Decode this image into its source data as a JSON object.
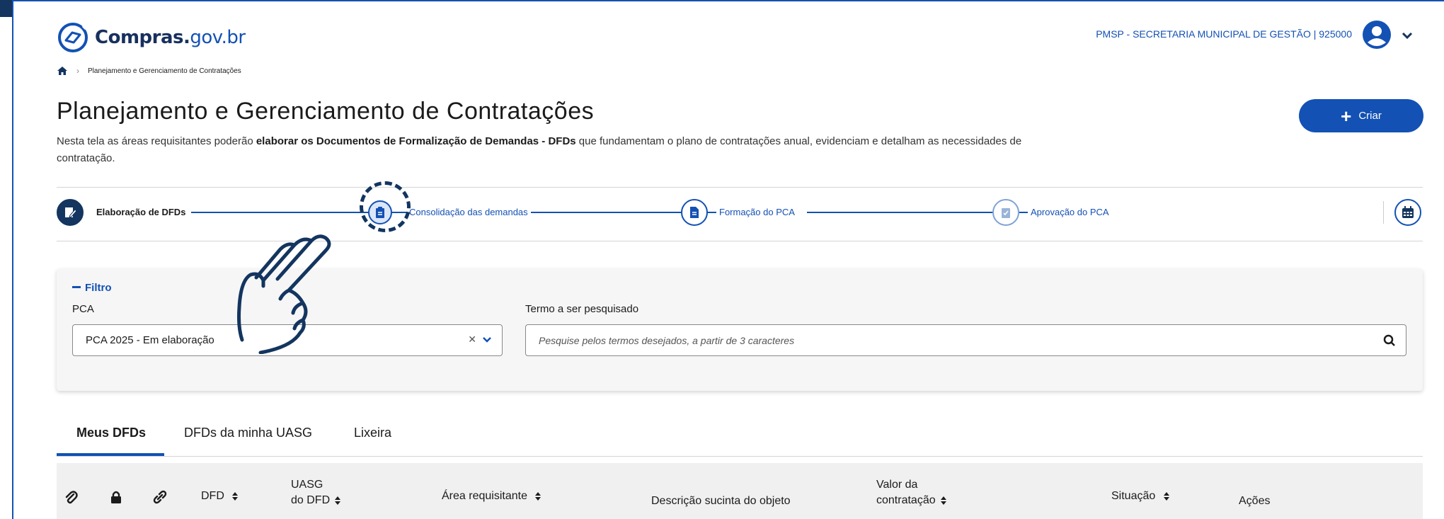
{
  "header": {
    "logo_text_main": "Compras.",
    "logo_text_suffix": "gov.br",
    "org_label": "PMSP - SECRETARIA MUNICIPAL DE GESTÃO | 925000"
  },
  "breadcrumb": {
    "current": "Planejamento e Gerenciamento de Contratações"
  },
  "page": {
    "title": "Planejamento e Gerenciamento de Contratações",
    "desc_part1": "Nesta tela as áreas requisitantes poderão ",
    "desc_bold": "elaborar os Documentos de Formalização de Demandas - DFDs",
    "desc_part2": " que fundamentam o plano de contratações anual, evidenciam e detalham as necessidades de contratação.",
    "create_label": "Criar"
  },
  "stepper": {
    "steps": [
      {
        "label": "Elaboração de DFDs",
        "icon": "edit-document-icon",
        "state": "active"
      },
      {
        "label": "Consolidação das demandas",
        "icon": "clipboard-icon",
        "state": "highlighted"
      },
      {
        "label": "Formação do PCA",
        "icon": "file-icon",
        "state": "default"
      },
      {
        "label": "Aprovação do PCA",
        "icon": "checklist-icon",
        "state": "muted"
      }
    ],
    "calendar_icon": "calendar-icon"
  },
  "filter": {
    "toggle_label": "Filtro",
    "pca_label": "PCA",
    "pca_value": "PCA 2025 - Em elaboração",
    "search_label": "Termo a ser pesquisado",
    "search_placeholder": "Pesquise pelos termos desejados, a partir de 3 caracteres"
  },
  "tabs": [
    {
      "label": "Meus DFDs",
      "active": true
    },
    {
      "label": "DFDs da minha UASG",
      "active": false
    },
    {
      "label": "Lixeira",
      "active": false
    }
  ],
  "table": {
    "icon_columns": [
      "paperclip-icon",
      "lock-icon",
      "link-icon"
    ],
    "columns": {
      "dfd": "DFD",
      "uasg_line1": "UASG",
      "uasg_line2": "do DFD",
      "area": "Área requisitante",
      "descricao": "Descrição sucinta do objeto",
      "valor_line1": "Valor da",
      "valor_line2": "contratação",
      "situacao": "Situação",
      "acoes": "Ações"
    }
  },
  "colors": {
    "primary": "#1351b4",
    "dark": "#13355f"
  }
}
